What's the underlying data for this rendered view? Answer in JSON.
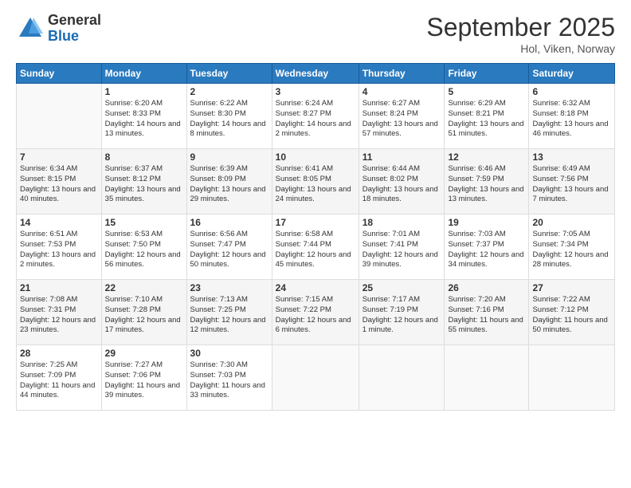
{
  "logo": {
    "general": "General",
    "blue": "Blue"
  },
  "title": "September 2025",
  "location": "Hol, Viken, Norway",
  "days_of_week": [
    "Sunday",
    "Monday",
    "Tuesday",
    "Wednesday",
    "Thursday",
    "Friday",
    "Saturday"
  ],
  "weeks": [
    [
      {
        "day": "",
        "sunrise": "",
        "sunset": "",
        "daylight": ""
      },
      {
        "day": "1",
        "sunrise": "Sunrise: 6:20 AM",
        "sunset": "Sunset: 8:33 PM",
        "daylight": "Daylight: 14 hours and 13 minutes."
      },
      {
        "day": "2",
        "sunrise": "Sunrise: 6:22 AM",
        "sunset": "Sunset: 8:30 PM",
        "daylight": "Daylight: 14 hours and 8 minutes."
      },
      {
        "day": "3",
        "sunrise": "Sunrise: 6:24 AM",
        "sunset": "Sunset: 8:27 PM",
        "daylight": "Daylight: 14 hours and 2 minutes."
      },
      {
        "day": "4",
        "sunrise": "Sunrise: 6:27 AM",
        "sunset": "Sunset: 8:24 PM",
        "daylight": "Daylight: 13 hours and 57 minutes."
      },
      {
        "day": "5",
        "sunrise": "Sunrise: 6:29 AM",
        "sunset": "Sunset: 8:21 PM",
        "daylight": "Daylight: 13 hours and 51 minutes."
      },
      {
        "day": "6",
        "sunrise": "Sunrise: 6:32 AM",
        "sunset": "Sunset: 8:18 PM",
        "daylight": "Daylight: 13 hours and 46 minutes."
      }
    ],
    [
      {
        "day": "7",
        "sunrise": "Sunrise: 6:34 AM",
        "sunset": "Sunset: 8:15 PM",
        "daylight": "Daylight: 13 hours and 40 minutes."
      },
      {
        "day": "8",
        "sunrise": "Sunrise: 6:37 AM",
        "sunset": "Sunset: 8:12 PM",
        "daylight": "Daylight: 13 hours and 35 minutes."
      },
      {
        "day": "9",
        "sunrise": "Sunrise: 6:39 AM",
        "sunset": "Sunset: 8:09 PM",
        "daylight": "Daylight: 13 hours and 29 minutes."
      },
      {
        "day": "10",
        "sunrise": "Sunrise: 6:41 AM",
        "sunset": "Sunset: 8:05 PM",
        "daylight": "Daylight: 13 hours and 24 minutes."
      },
      {
        "day": "11",
        "sunrise": "Sunrise: 6:44 AM",
        "sunset": "Sunset: 8:02 PM",
        "daylight": "Daylight: 13 hours and 18 minutes."
      },
      {
        "day": "12",
        "sunrise": "Sunrise: 6:46 AM",
        "sunset": "Sunset: 7:59 PM",
        "daylight": "Daylight: 13 hours and 13 minutes."
      },
      {
        "day": "13",
        "sunrise": "Sunrise: 6:49 AM",
        "sunset": "Sunset: 7:56 PM",
        "daylight": "Daylight: 13 hours and 7 minutes."
      }
    ],
    [
      {
        "day": "14",
        "sunrise": "Sunrise: 6:51 AM",
        "sunset": "Sunset: 7:53 PM",
        "daylight": "Daylight: 13 hours and 2 minutes."
      },
      {
        "day": "15",
        "sunrise": "Sunrise: 6:53 AM",
        "sunset": "Sunset: 7:50 PM",
        "daylight": "Daylight: 12 hours and 56 minutes."
      },
      {
        "day": "16",
        "sunrise": "Sunrise: 6:56 AM",
        "sunset": "Sunset: 7:47 PM",
        "daylight": "Daylight: 12 hours and 50 minutes."
      },
      {
        "day": "17",
        "sunrise": "Sunrise: 6:58 AM",
        "sunset": "Sunset: 7:44 PM",
        "daylight": "Daylight: 12 hours and 45 minutes."
      },
      {
        "day": "18",
        "sunrise": "Sunrise: 7:01 AM",
        "sunset": "Sunset: 7:41 PM",
        "daylight": "Daylight: 12 hours and 39 minutes."
      },
      {
        "day": "19",
        "sunrise": "Sunrise: 7:03 AM",
        "sunset": "Sunset: 7:37 PM",
        "daylight": "Daylight: 12 hours and 34 minutes."
      },
      {
        "day": "20",
        "sunrise": "Sunrise: 7:05 AM",
        "sunset": "Sunset: 7:34 PM",
        "daylight": "Daylight: 12 hours and 28 minutes."
      }
    ],
    [
      {
        "day": "21",
        "sunrise": "Sunrise: 7:08 AM",
        "sunset": "Sunset: 7:31 PM",
        "daylight": "Daylight: 12 hours and 23 minutes."
      },
      {
        "day": "22",
        "sunrise": "Sunrise: 7:10 AM",
        "sunset": "Sunset: 7:28 PM",
        "daylight": "Daylight: 12 hours and 17 minutes."
      },
      {
        "day": "23",
        "sunrise": "Sunrise: 7:13 AM",
        "sunset": "Sunset: 7:25 PM",
        "daylight": "Daylight: 12 hours and 12 minutes."
      },
      {
        "day": "24",
        "sunrise": "Sunrise: 7:15 AM",
        "sunset": "Sunset: 7:22 PM",
        "daylight": "Daylight: 12 hours and 6 minutes."
      },
      {
        "day": "25",
        "sunrise": "Sunrise: 7:17 AM",
        "sunset": "Sunset: 7:19 PM",
        "daylight": "Daylight: 12 hours and 1 minute."
      },
      {
        "day": "26",
        "sunrise": "Sunrise: 7:20 AM",
        "sunset": "Sunset: 7:16 PM",
        "daylight": "Daylight: 11 hours and 55 minutes."
      },
      {
        "day": "27",
        "sunrise": "Sunrise: 7:22 AM",
        "sunset": "Sunset: 7:12 PM",
        "daylight": "Daylight: 11 hours and 50 minutes."
      }
    ],
    [
      {
        "day": "28",
        "sunrise": "Sunrise: 7:25 AM",
        "sunset": "Sunset: 7:09 PM",
        "daylight": "Daylight: 11 hours and 44 minutes."
      },
      {
        "day": "29",
        "sunrise": "Sunrise: 7:27 AM",
        "sunset": "Sunset: 7:06 PM",
        "daylight": "Daylight: 11 hours and 39 minutes."
      },
      {
        "day": "30",
        "sunrise": "Sunrise: 7:30 AM",
        "sunset": "Sunset: 7:03 PM",
        "daylight": "Daylight: 11 hours and 33 minutes."
      },
      {
        "day": "",
        "sunrise": "",
        "sunset": "",
        "daylight": ""
      },
      {
        "day": "",
        "sunrise": "",
        "sunset": "",
        "daylight": ""
      },
      {
        "day": "",
        "sunrise": "",
        "sunset": "",
        "daylight": ""
      },
      {
        "day": "",
        "sunrise": "",
        "sunset": "",
        "daylight": ""
      }
    ]
  ]
}
